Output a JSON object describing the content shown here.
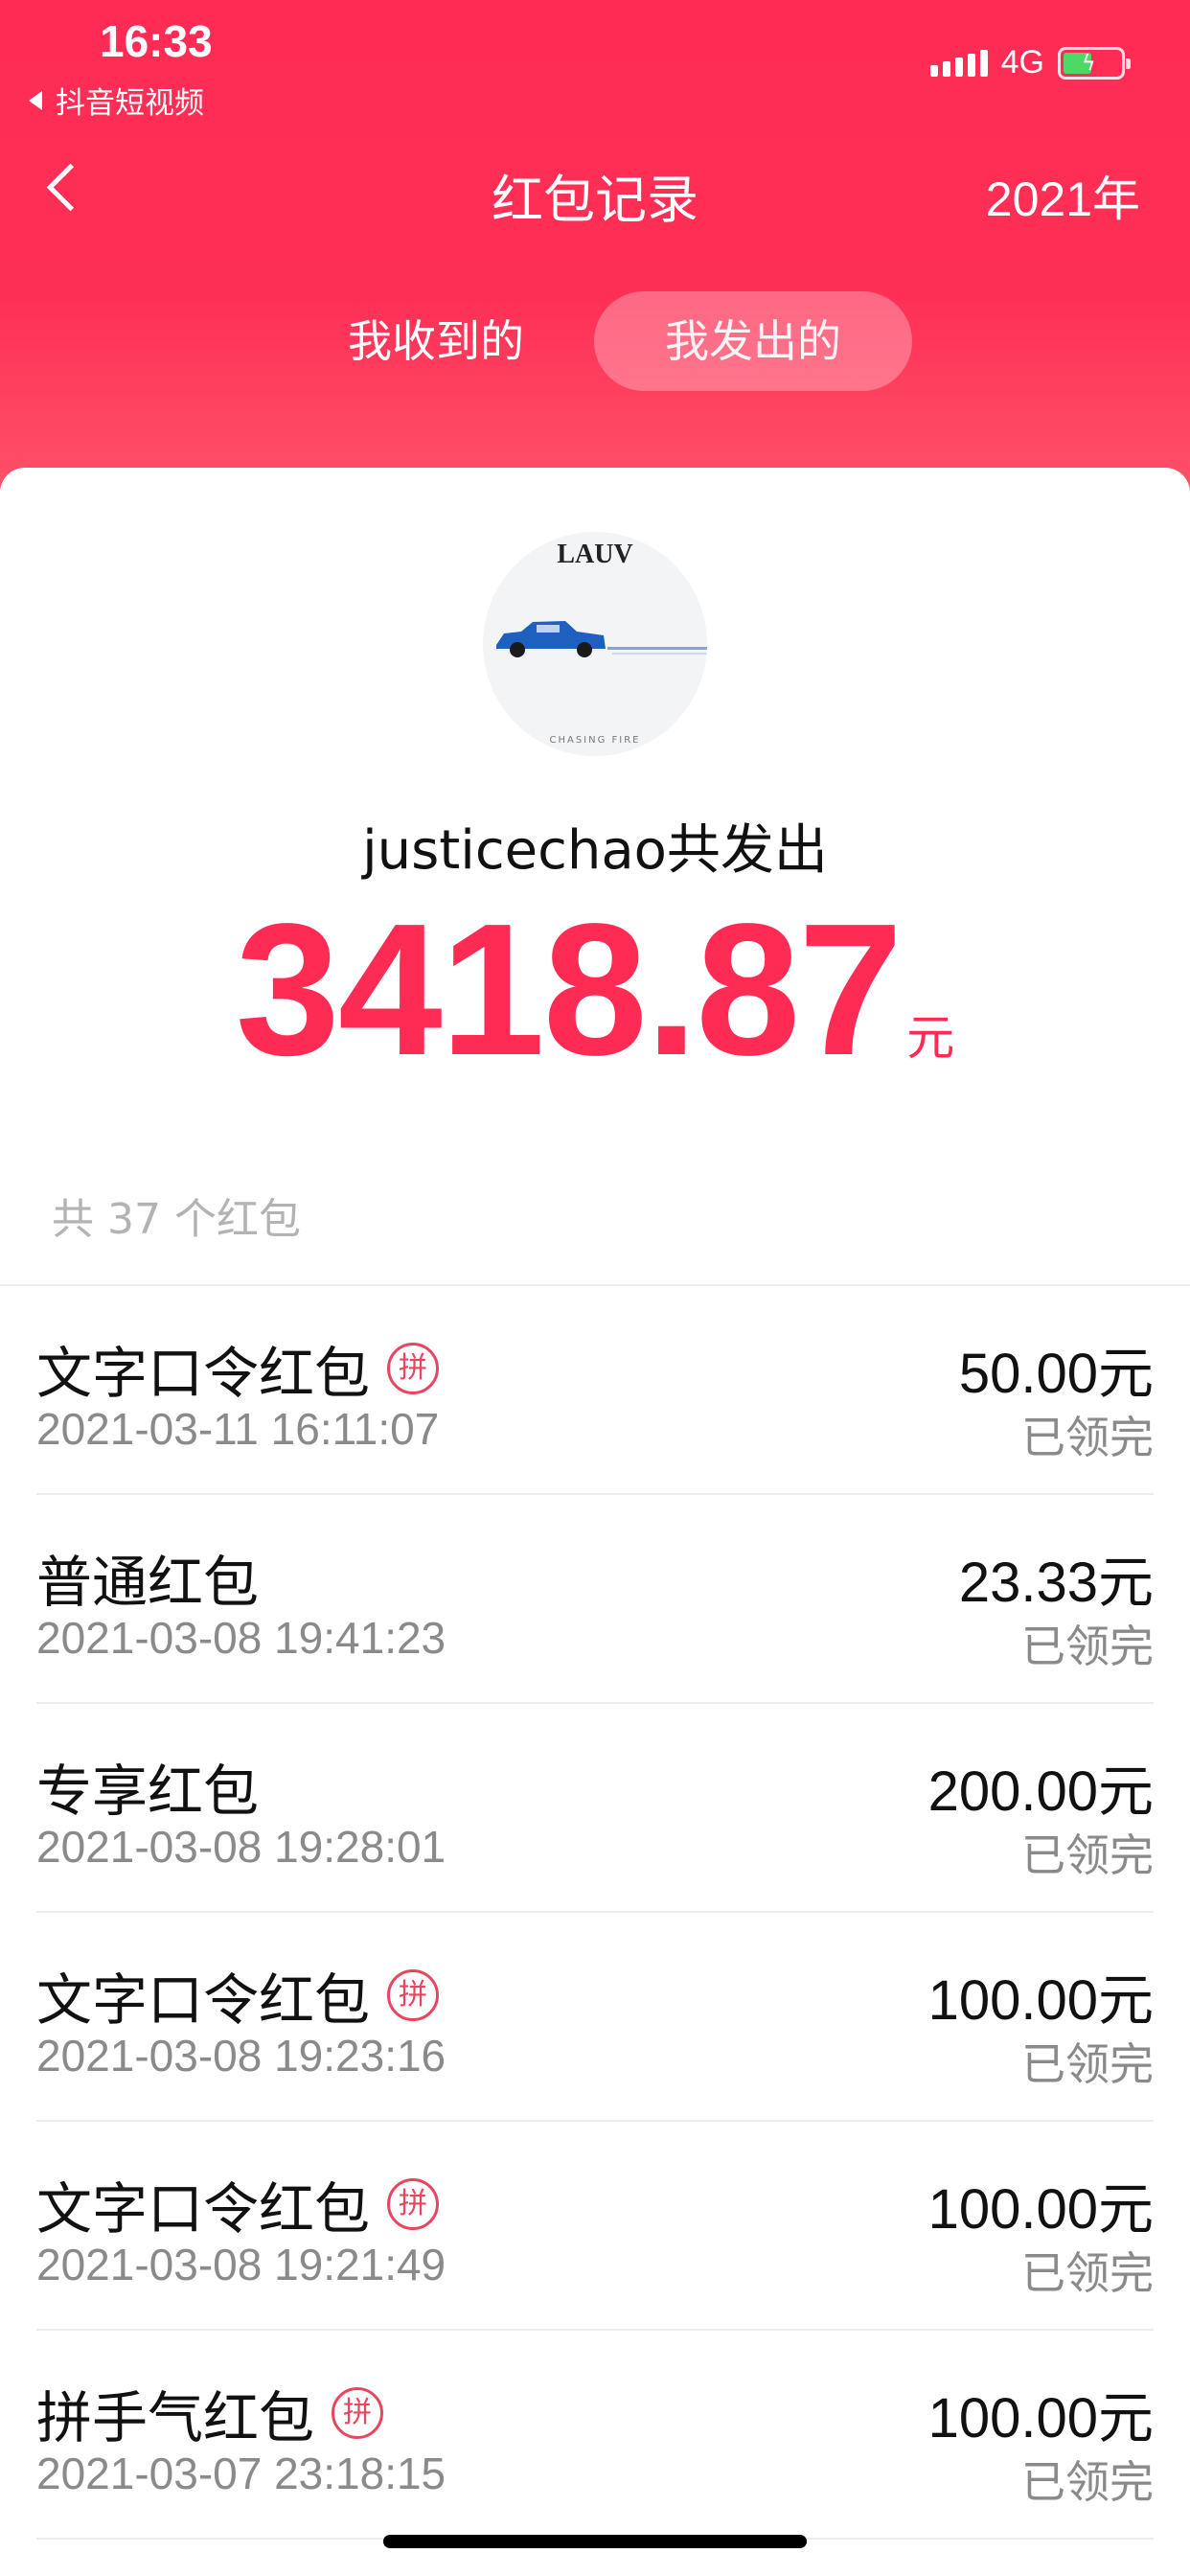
{
  "status_bar": {
    "time": "16:33",
    "back_app": "抖音短视频",
    "network": "4G"
  },
  "nav": {
    "title": "红包记录",
    "year": "2021年"
  },
  "tabs": [
    {
      "label": "我收到的",
      "active": false
    },
    {
      "label": "我发出的",
      "active": true
    }
  ],
  "summary": {
    "avatar_text": "LAUV",
    "avatar_subtext": "CHASING FIRE",
    "sender": "justicechao共发出",
    "total": "3418.87",
    "unit": "元",
    "count": "共 37 个红包"
  },
  "records": [
    {
      "name": "文字口令红包",
      "tag": "拼",
      "date": "2021-03-11 16:11:07",
      "amount": "50.00元",
      "status": "已领完"
    },
    {
      "name": "普通红包",
      "tag": "",
      "date": "2021-03-08 19:41:23",
      "amount": "23.33元",
      "status": "已领完"
    },
    {
      "name": "专享红包",
      "tag": "",
      "date": "2021-03-08 19:28:01",
      "amount": "200.00元",
      "status": "已领完"
    },
    {
      "name": "文字口令红包",
      "tag": "拼",
      "date": "2021-03-08 19:23:16",
      "amount": "100.00元",
      "status": "已领完"
    },
    {
      "name": "文字口令红包",
      "tag": "拼",
      "date": "2021-03-08 19:21:49",
      "amount": "100.00元",
      "status": "已领完"
    },
    {
      "name": "拼手气红包",
      "tag": "拼",
      "date": "2021-03-07 23:18:15",
      "amount": "100.00元",
      "status": "已领完"
    }
  ],
  "colors": {
    "brand": "#fe2c55",
    "tag": "#e8455f"
  }
}
